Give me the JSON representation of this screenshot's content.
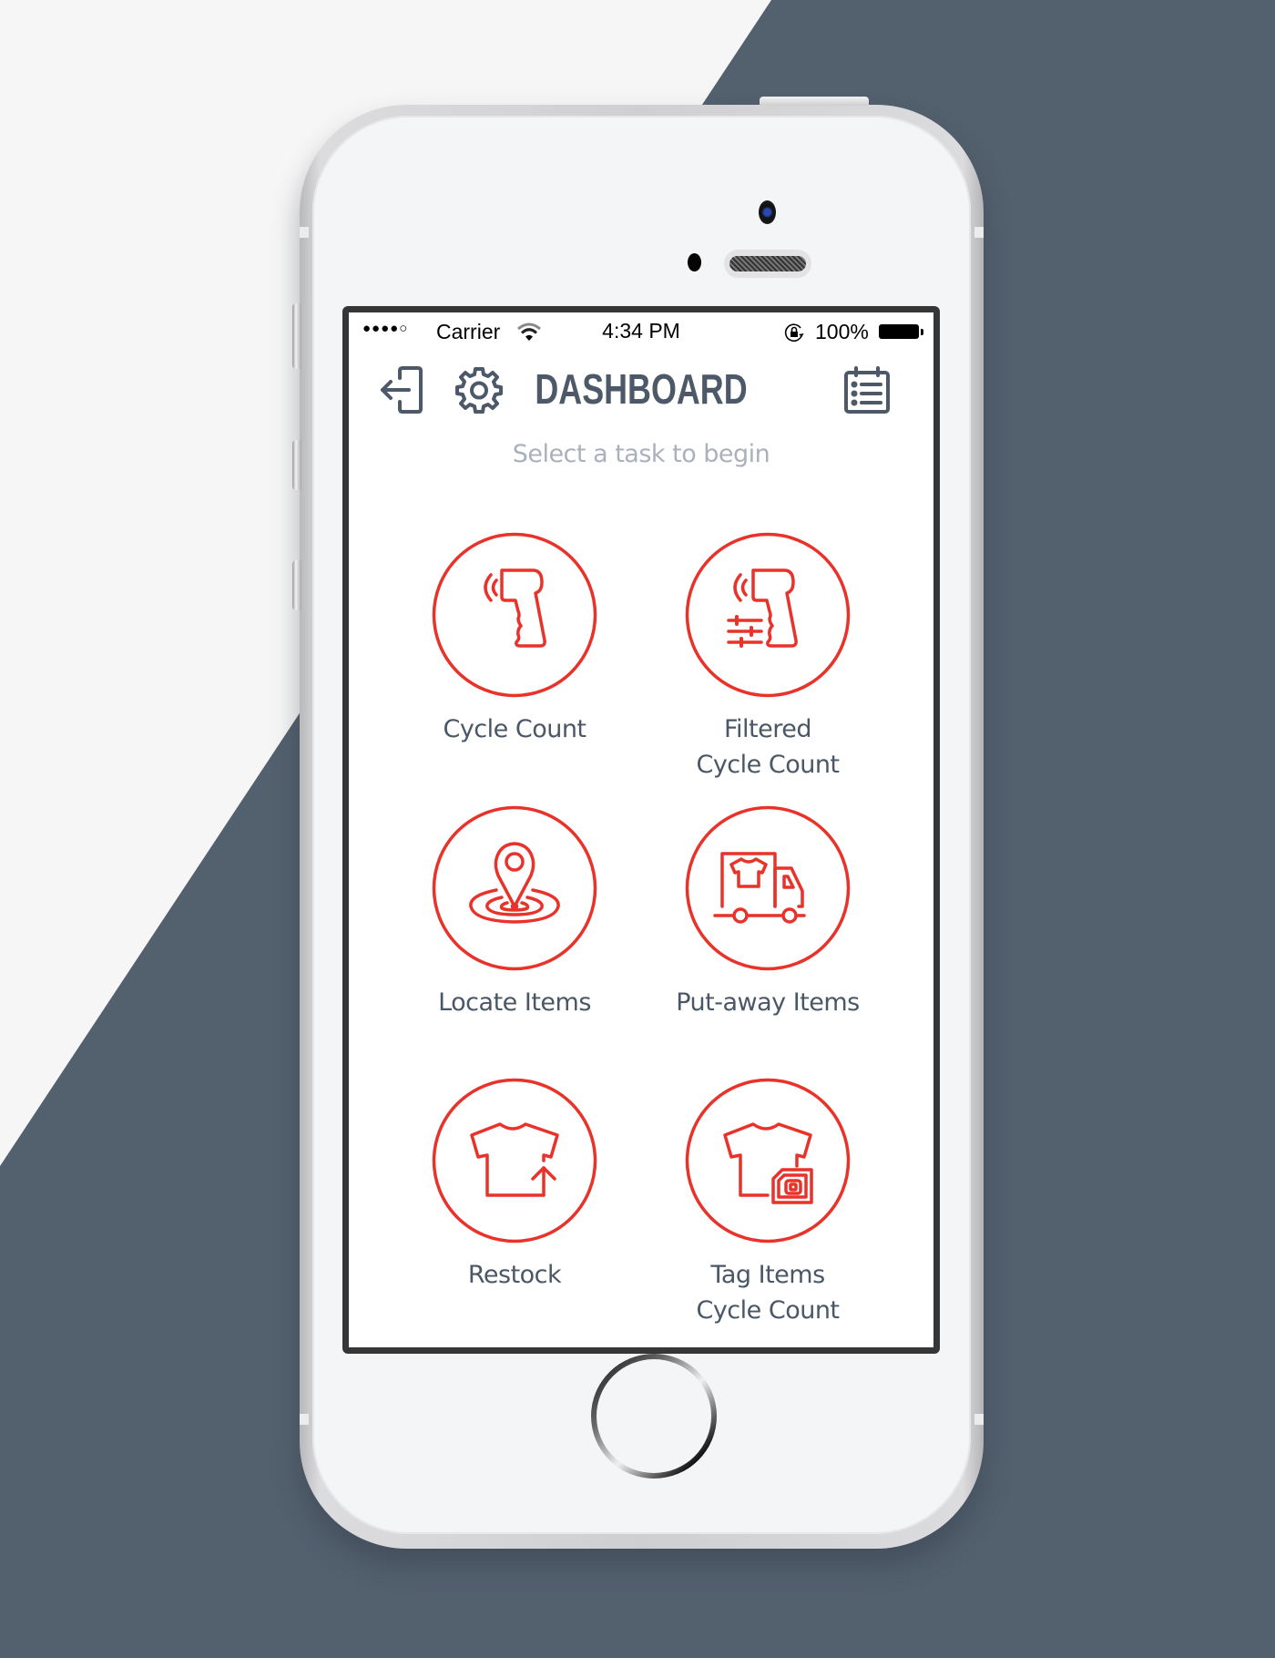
{
  "colors": {
    "background_light": "#f6f6f6",
    "background_dark": "#53606e",
    "accent_red": "#e8322a",
    "title_text": "#4d5968",
    "subtitle_text": "#a9b1bb",
    "label_text": "#4a5766"
  },
  "status_bar": {
    "signal": "●●●●○",
    "carrier": "Carrier",
    "wifi_icon": "wifi-icon",
    "time": "4:34 PM",
    "rotation_lock_icon": "rotation-lock-icon",
    "battery_percent": "100%",
    "battery_icon": "battery-full-icon"
  },
  "header": {
    "logout_icon": "logout-icon",
    "settings_icon": "gear-icon",
    "title": "DASHBOARD",
    "tasks_icon": "checklist-clipboard-icon"
  },
  "subtitle": "Select a task to begin",
  "tasks": [
    {
      "label_line1": "Cycle Count",
      "label_line2": "",
      "icon": "rfid-scanner-icon"
    },
    {
      "label_line1": "Filtered",
      "label_line2": "Cycle Count",
      "icon": "rfid-scanner-filter-icon"
    },
    {
      "label_line1": "Locate Items",
      "label_line2": "",
      "icon": "location-pin-target-icon"
    },
    {
      "label_line1": "Put-away Items",
      "label_line2": "",
      "icon": "delivery-truck-shirt-icon"
    },
    {
      "label_line1": "Restock",
      "label_line2": "",
      "icon": "shirt-arrow-up-icon"
    },
    {
      "label_line1": "Tag Items",
      "label_line2": "Cycle Count",
      "icon": "shirt-rfid-tag-icon"
    }
  ]
}
